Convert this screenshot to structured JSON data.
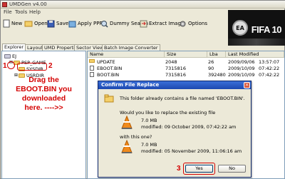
{
  "window": {
    "title": "UMDGen v4.00"
  },
  "menu": [
    "File",
    "Tools",
    "Help"
  ],
  "toolbar": {
    "new": "New",
    "open": "Open",
    "save": "Save",
    "apply_ppf": "Apply PPF",
    "dummy_search": "Dummy Search",
    "extract_image": "Extract Image",
    "options": "Options"
  },
  "banner": {
    "brand": "FIFA 10",
    "badge": "EA",
    "subtitle": "SPORTS"
  },
  "tabs": [
    "Explorer",
    "Layout",
    "UMD Properties",
    "Sector Viewer",
    "Batch Image Converter"
  ],
  "tree": {
    "root": "EJ",
    "psp_game": "PSP_GAME",
    "sysdir": "SYSDIR",
    "usrdir": "USRDIR"
  },
  "annotations": {
    "step1": "1",
    "step2": "2",
    "step3": "3",
    "callout_line1": "Drag the",
    "callout_line2": "EBOOT.BIN you",
    "callout_line3": "downloaded",
    "callout_line4": "here.   ---->>"
  },
  "file_list": {
    "columns": [
      "Name",
      "Size",
      "Lba",
      "Last Modified"
    ],
    "rows": [
      {
        "name": "UPDATE",
        "size": "2048",
        "lba": "26",
        "modified": "2009/09/06",
        "time": "13:57:07"
      },
      {
        "name": "EBOOT.BIN",
        "size": "7315816",
        "lba": "90",
        "modified": "2009/10/09",
        "time": "07:42:22"
      },
      {
        "name": "BOOT.BIN",
        "size": "7315816",
        "lba": "392480",
        "modified": "2009/10/09",
        "time": "07:42:22"
      }
    ]
  },
  "dialog": {
    "title": "Confirm File Replace",
    "message": "This folder already contains a file named 'EBOOT.BIN'.",
    "question": "Would you like to replace the existing file",
    "existing_size": "7.0 MB",
    "existing_modified": "modified: 09 October 2009, 07:42:22 am",
    "with_this": "with this one?",
    "new_size": "7.0 MB",
    "new_modified": "modified: 05 November 2009, 11:06:16 am",
    "yes": "Yes",
    "no": "No"
  }
}
